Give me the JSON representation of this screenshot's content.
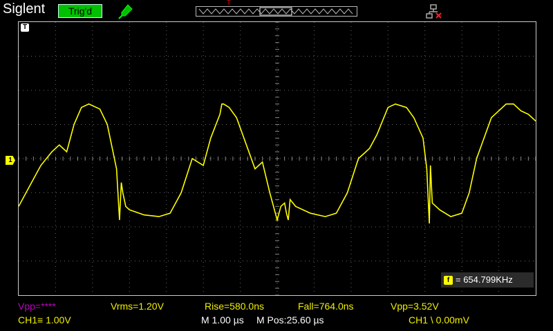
{
  "header": {
    "brand": "Siglent",
    "trigger_status": "Trig'd",
    "icons": [
      "probe-icon",
      "network-disconnected-icon"
    ],
    "colors": {
      "trigger_bg": "#00c000",
      "trace": "#ffff00",
      "probe_icon": "#00c000",
      "net_icon_x": "#ff2020"
    }
  },
  "screen": {
    "trigger_marker": "T",
    "channel_marker": "1",
    "frequency_icon": "f",
    "frequency": "= 654.799KHz"
  },
  "measurements": {
    "vpp_ch2": "Vpp=****",
    "vrms": "Vrms=1.20V",
    "rise": "Rise=580.0ns",
    "fall": "Fall=764.0ns",
    "vpp": "Vpp=3.52V"
  },
  "status": {
    "ch1_scale": "CH1≡ 1.00V",
    "timebase": "M 1.00 µs",
    "mpos": "M Pos:25.60 µs",
    "trigger": "CH1 \\ 0.00mV"
  },
  "chart_data": {
    "type": "line",
    "title": "",
    "xlabel": "",
    "ylabel": "",
    "x_units": "µs (1.00 µs/div)",
    "y_units": "V (1.00 V/div)",
    "xlim": [
      -7,
      7
    ],
    "ylim": [
      -4,
      4
    ],
    "grid": true,
    "series": [
      {
        "name": "",
        "color": "#ffff00",
        "x": [
          -7.0,
          -6.7,
          -6.4,
          -6.1,
          -5.9,
          -5.7,
          -5.5,
          -5.3,
          -5.1,
          -4.8,
          -4.6,
          -4.35,
          -4.27,
          -4.22,
          -4.18,
          -4.1,
          -4.0,
          -3.6,
          -3.2,
          -2.9,
          -2.6,
          -2.3,
          -2.0,
          -1.8,
          -1.55,
          -1.5,
          -1.45,
          -1.3,
          -1.1,
          -0.9,
          -0.6,
          -0.4,
          -0.2,
          0.0,
          0.1,
          0.2,
          0.25,
          0.3,
          0.35,
          0.5,
          0.9,
          1.3,
          1.6,
          1.9,
          2.2,
          2.5,
          2.7,
          3.0,
          3.2,
          3.5,
          3.7,
          3.95,
          4.05,
          4.12,
          4.15,
          4.2,
          4.4,
          4.7,
          5.0,
          5.2,
          5.4,
          5.8,
          6.2,
          6.4,
          6.6,
          6.8,
          6.9,
          7.0
        ],
        "y": [
          -1.4,
          -0.8,
          -0.2,
          0.2,
          0.4,
          0.2,
          1.0,
          1.5,
          1.6,
          1.45,
          1.0,
          -0.3,
          -1.8,
          -0.7,
          -1.0,
          -1.4,
          -1.5,
          -1.65,
          -1.7,
          -1.6,
          -1.0,
          0.0,
          -0.2,
          0.6,
          1.3,
          1.6,
          1.6,
          1.5,
          1.2,
          0.6,
          -0.3,
          -0.1,
          -1.0,
          -1.8,
          -1.4,
          -1.3,
          -1.6,
          -1.8,
          -1.2,
          -1.4,
          -1.6,
          -1.7,
          -1.6,
          -1.0,
          0.0,
          0.3,
          0.7,
          1.5,
          1.6,
          1.5,
          1.2,
          0.6,
          -0.3,
          -1.9,
          -0.2,
          -1.3,
          -1.5,
          -1.7,
          -1.6,
          -1.0,
          0.0,
          1.2,
          1.6,
          1.6,
          1.4,
          1.3,
          1.2,
          1.1
        ]
      }
    ]
  }
}
